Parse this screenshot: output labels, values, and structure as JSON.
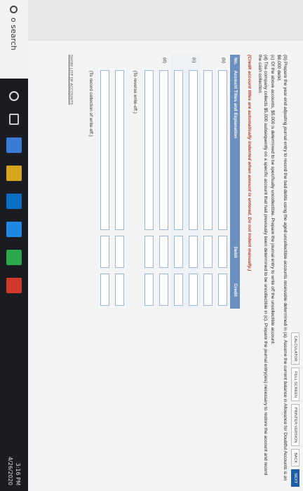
{
  "toolbar": {
    "calculator": "CALCULATOR",
    "full_screen": "FULL SCREEN",
    "printer_version": "PRINTER VERSION",
    "back": "BACK",
    "next": "NEXT"
  },
  "problem": {
    "b": "(b) Prepare the year-end adjusting journal entry to record the bad debts using the aged uncollectible accounts receivable determined in (a). Assume the current balance in Allowance for Doubtful Accounts is an $8,000 debit.",
    "c": "(c) Of the above accounts, $5,000 is determined to be specifically uncollectible. Prepare the journal entry to write off the uncollectible account.",
    "d": "(d) The company collects $5,000 subsequently on a specific account that had previously been determined to be uncollectible in (c). Prepare the journal entry(ies) necessary to restore the account and record the cash collection.",
    "instruction": "(Credit account titles are automatically indented when amount is entered. Do not indent manually.)"
  },
  "journal": {
    "headers": {
      "no": "No.",
      "account": "Account Titles and Explanation",
      "debit": "Debit",
      "credit": "Credit"
    },
    "labels": {
      "b": "(b)",
      "c": "(c)",
      "d": "(d)"
    },
    "memo_reverse": "(To reverse write-off.)",
    "memo_collection": "(To record collection of write-off.)"
  },
  "show_list": "SHOW LIST OF ACCOUNTS",
  "taskbar": {
    "search": "o search",
    "time": "3:16 PM",
    "date": "4/26/2020"
  }
}
